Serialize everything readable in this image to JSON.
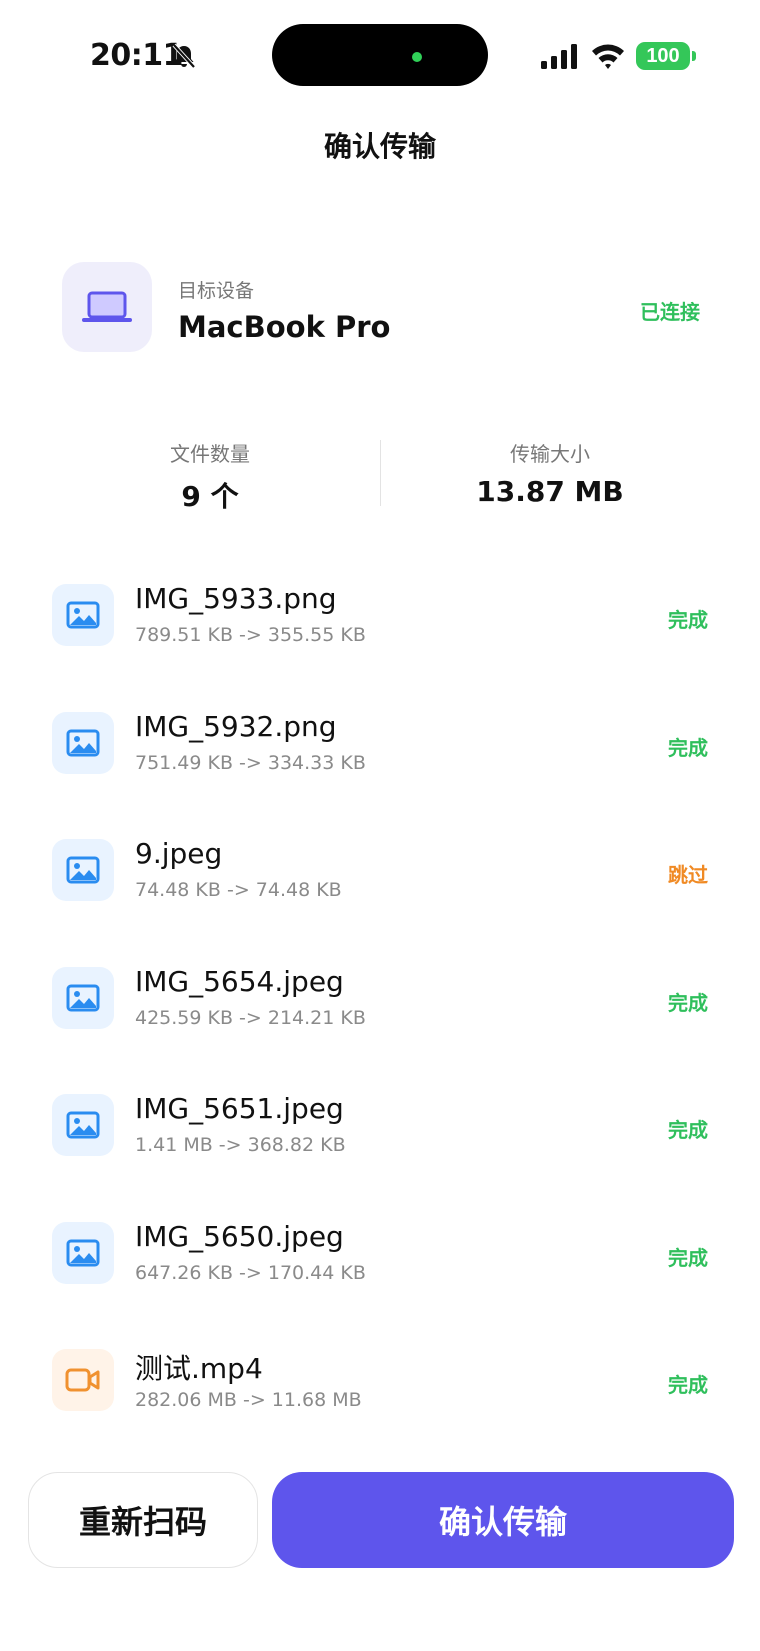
{
  "status_bar": {
    "time": "20:11",
    "battery": "100",
    "icons": [
      "bell-slash-icon",
      "signal-icon",
      "wifi-icon",
      "battery-icon"
    ]
  },
  "nav": {
    "title": "确认传输"
  },
  "device": {
    "label": "目标设备",
    "name": "MacBook Pro",
    "status": "已连接",
    "icon": "laptop-icon"
  },
  "stats": {
    "count_label": "文件数量",
    "count_value": "9 个",
    "size_label": "传输大小",
    "size_value": "13.87 MB"
  },
  "files": [
    {
      "name": "IMG_5933.png",
      "size": "789.51 KB -> 355.55 KB",
      "status": "完成",
      "type": "image"
    },
    {
      "name": "IMG_5932.png",
      "size": "751.49 KB -> 334.33 KB",
      "status": "完成",
      "type": "image"
    },
    {
      "name": "9.jpeg",
      "size": "74.48 KB -> 74.48 KB",
      "status": "跳过",
      "type": "image"
    },
    {
      "name": "IMG_5654.jpeg",
      "size": "425.59 KB -> 214.21 KB",
      "status": "完成",
      "type": "image"
    },
    {
      "name": "IMG_5651.jpeg",
      "size": "1.41 MB -> 368.82 KB",
      "status": "完成",
      "type": "image"
    },
    {
      "name": "IMG_5650.jpeg",
      "size": "647.26 KB -> 170.44 KB",
      "status": "完成",
      "type": "image"
    },
    {
      "name": "测试.mp4",
      "size": "282.06 MB -> 11.68 MB",
      "status": "完成",
      "type": "video"
    }
  ],
  "buttons": {
    "rescan": "重新扫码",
    "confirm": "确认传输"
  },
  "colors": {
    "accent": "#5e55ec",
    "success": "#2fbf5c",
    "warning": "#f08a24",
    "image_icon": "#2a8cf0",
    "video_icon": "#f0912f"
  }
}
